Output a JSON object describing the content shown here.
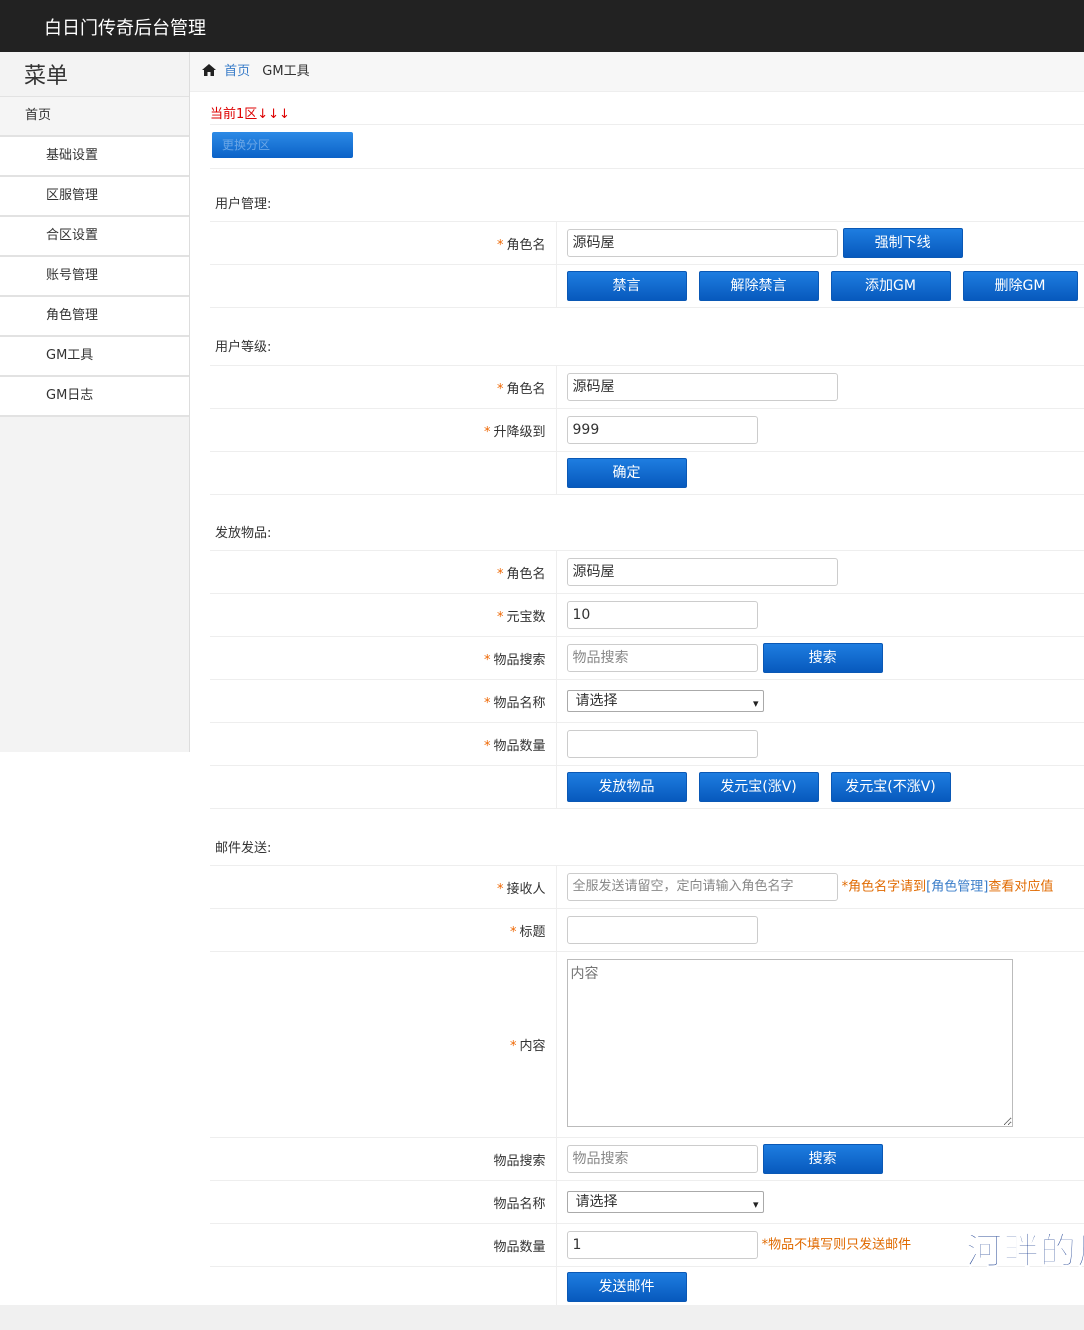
{
  "app": {
    "title": "白日门传奇后台管理"
  },
  "sidebar": {
    "menu_title": "菜单",
    "items": [
      {
        "label": "首页"
      },
      {
        "label": "基础设置"
      },
      {
        "label": "区服管理"
      },
      {
        "label": "合区设置"
      },
      {
        "label": "账号管理"
      },
      {
        "label": "角色管理"
      },
      {
        "label": "GM工具"
      },
      {
        "label": "GM日志"
      }
    ]
  },
  "breadcrumb": {
    "home": "首页",
    "current": "GM工具"
  },
  "zone": {
    "current": "当前1区↓↓↓",
    "switch_button": "更换分区"
  },
  "user_manage": {
    "section": "用户管理:",
    "role_label": "角色名",
    "role_value": "源码屋",
    "force_offline": "强制下线",
    "buttons": [
      "禁言",
      "解除禁言",
      "添加GM",
      "删除GM"
    ]
  },
  "user_level": {
    "section": "用户等级:",
    "role_label": "角色名",
    "role_value": "源码屋",
    "level_label": "升降级到",
    "level_value": "999",
    "confirm": "确定"
  },
  "items": {
    "section": "发放物品:",
    "role_label": "角色名",
    "role_value": "源码屋",
    "yuanbao_label": "元宝数",
    "yuanbao_value": "10",
    "search_label": "物品搜索",
    "search_placeholder": "物品搜索",
    "search_button": "搜索",
    "name_label": "物品名称",
    "name_select": "请选择",
    "qty_label": "物品数量",
    "qty_value": "",
    "buttons": [
      "发放物品",
      "发元宝(涨V)",
      "发元宝(不涨V)"
    ]
  },
  "mail": {
    "section": "邮件发送:",
    "receiver_label": "接收人",
    "receiver_placeholder": "全服发送请留空，定向请输入角色名字",
    "receiver_hint_pre": "*角色名字请到",
    "receiver_hint_link": "[角色管理]",
    "receiver_hint_post": "查看对应值",
    "title_label": "标题",
    "title_value": "",
    "content_label": "内容",
    "content_placeholder": "内容",
    "search_label": "物品搜索",
    "search_placeholder": "物品搜索",
    "search_button": "搜索",
    "name_label": "物品名称",
    "name_select": "请选择",
    "qty_label": "物品数量",
    "qty_value": "1",
    "qty_hint": "*物品不填写则只发送邮件",
    "send_button": "发送邮件"
  },
  "watermark": "河畔的風",
  "colors": {
    "topbar": "#222222",
    "button": "#1e7de0",
    "hint": "#e06a00",
    "zone_current": "#dd0000"
  }
}
